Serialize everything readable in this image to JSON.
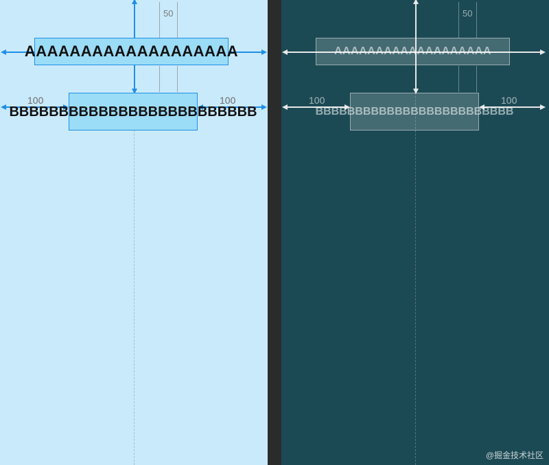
{
  "left": {
    "text_a": "AAAAAAAAAAAAAAAAAAA",
    "text_b": "BBBBBBBBBBBBBBBBBBBBBBBBB",
    "margin_top": "50",
    "margin_left": "100",
    "margin_right": "100"
  },
  "right": {
    "text_a": "AAAAAAAAAAAAAAAAAAA",
    "text_b": "BBBBBBBBBBBBBBBBBBBBBBBBB",
    "margin_top": "50",
    "margin_left": "100",
    "margin_right": "100"
  },
  "watermark": "@掘金技术社区"
}
